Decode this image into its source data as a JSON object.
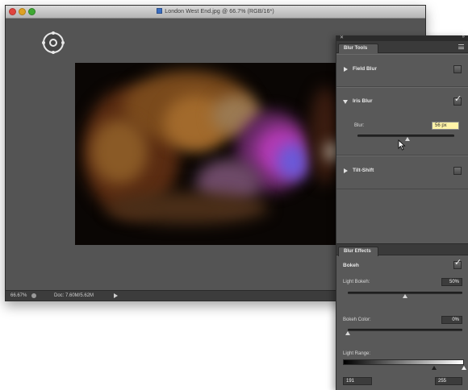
{
  "document": {
    "title": "London West End.jpg @ 66.7% (RGB/16*)",
    "status_zoom": "66.67%",
    "status_doc": "Doc: 7.60M/5.62M"
  },
  "blur_tools": {
    "tab_label": "Blur Tools",
    "field_blur": {
      "label": "Field Blur",
      "checked": false
    },
    "iris_blur": {
      "label": "Iris Blur",
      "checked": true,
      "blur_label": "Blur:",
      "blur_value": "56 px",
      "slider_fraction": 0.52
    },
    "tilt_shift": {
      "label": "Tilt-Shift",
      "checked": false
    }
  },
  "blur_effects": {
    "tab_label": "Blur Effects",
    "bokeh_label": "Bokeh",
    "bokeh_checked": true,
    "light_bokeh_label": "Light Bokeh:",
    "light_bokeh_value": "50%",
    "light_bokeh_fraction": 0.5,
    "bokeh_color_label": "Bokeh Color:",
    "bokeh_color_value": "0%",
    "bokeh_color_fraction": 0.0,
    "light_range_label": "Light Range:",
    "light_range_low": "191",
    "light_range_high": "255",
    "light_range_low_fraction": 0.75,
    "light_range_high_fraction": 1.0
  },
  "colors": {
    "panel_bg": "#595959",
    "canvas_bg": "#545454",
    "highlight_field": "#fff3a8"
  },
  "icons": {
    "close": "close-icon",
    "panel_menu": "panel-menu-icon",
    "iris_pin": "iris-pin-icon",
    "cursor": "mouse-cursor-icon"
  }
}
